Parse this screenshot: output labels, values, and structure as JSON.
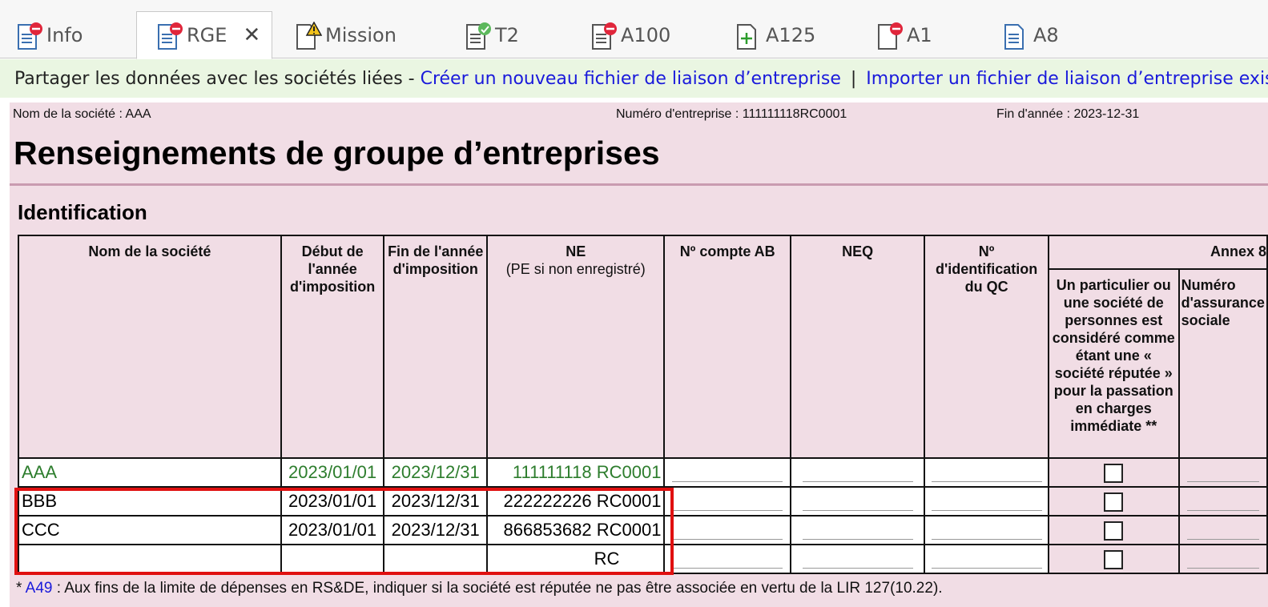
{
  "tabs": [
    {
      "label": "Info",
      "icon": "document-error-icon"
    },
    {
      "label": "RGE",
      "icon": "document-error-icon",
      "active": true,
      "close": "✕"
    },
    {
      "label": "Mission",
      "icon": "document-warning-icon"
    },
    {
      "label": "T2",
      "icon": "document-check-icon"
    },
    {
      "label": "A100",
      "icon": "document-error-icon"
    },
    {
      "label": "A125",
      "icon": "document-add-icon"
    },
    {
      "label": "A1",
      "icon": "document-error-icon"
    },
    {
      "label": "A8",
      "icon": "document-icon"
    }
  ],
  "share": {
    "text": "Partager les données avec les sociétés liées -",
    "create_link": "Créer un nouveau fichier de liaison d’entreprise",
    "separator": "|",
    "import_link": "Importer un fichier de liaison d’entreprise existant"
  },
  "header": {
    "company": "Nom de la société : AAA",
    "business_number": "Numéro d'entreprise : 111111118RC0001",
    "year_end": "Fin d'année : 2023-12-31"
  },
  "title": "Renseignements de groupe d’entreprises",
  "section": "Identification",
  "columns": {
    "name": "Nom de la société",
    "start": "Début de l'année d'imposition",
    "end": "Fin de l'année d'imposition",
    "ne": "NE",
    "ne_sub": "(PE si non enregistré)",
    "ab": "Nº compte AB",
    "neq": "NEQ",
    "qc": "Nº d'identification du QC",
    "annex": "Annex 8",
    "deemed": "Un particulier ou une société de personnes est considéré comme étant une « société réputée » pour la passation en charges immédiate **",
    "sin": "Numéro d'assurance sociale"
  },
  "rows": [
    {
      "name": "AAA",
      "start": "2023/01/01",
      "end": "2023/12/31",
      "ne": "111111118 RC0001"
    },
    {
      "name": "BBB",
      "start": "2023/01/01",
      "end": "2023/12/31",
      "ne": "222222226 RC0001"
    },
    {
      "name": "CCC",
      "start": "2023/01/01",
      "end": "2023/12/31",
      "ne": "866853682 RC0001"
    },
    {
      "name": "",
      "start": "",
      "end": "",
      "ne": "RC"
    }
  ],
  "footnote": {
    "star": "*",
    "link": "A49",
    "text": ": Aux fins de la limite de dépenses en RS&DE, indiquer si la société est réputée ne pas être associée en vertu de la LIR 127(10.22)."
  },
  "colors": {
    "form_bg": "#f1dde5",
    "share_bg": "#eaf6e2",
    "link": "#1a1adb",
    "green_text": "#2d7d2d",
    "highlight": "#e01010"
  }
}
